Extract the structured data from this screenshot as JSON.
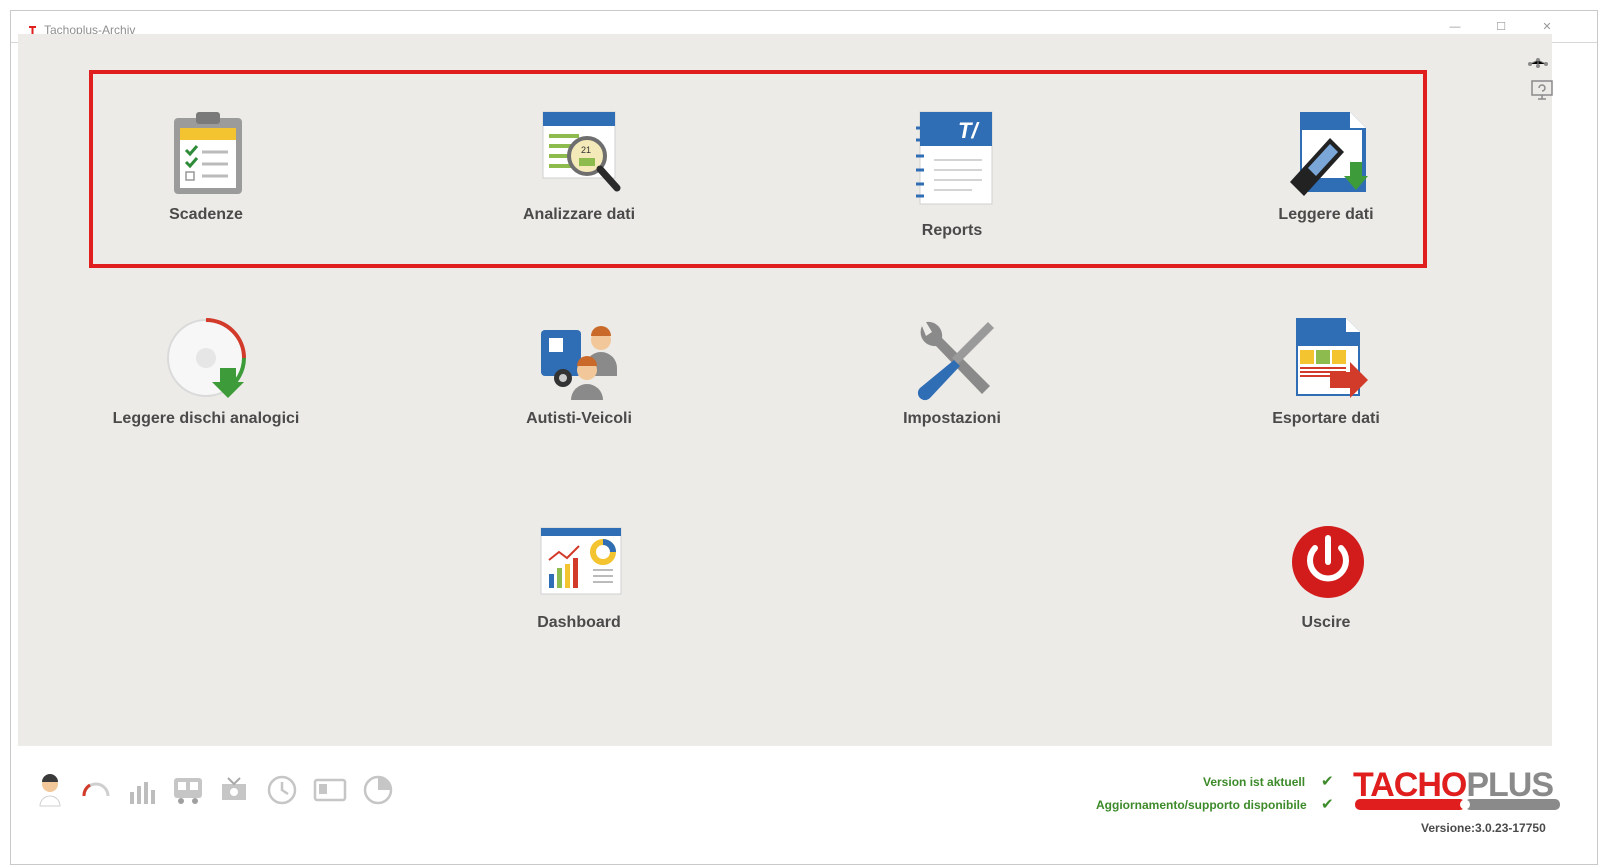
{
  "window": {
    "title": "Tachoplus-Archiv",
    "controls": [
      "minimize",
      "maximize",
      "close"
    ]
  },
  "tiles": [
    {
      "label": "Scadenze",
      "icon": "clipboard-checklist-icon"
    },
    {
      "label": "Analizzare dati",
      "icon": "calendar-magnifier-icon"
    },
    {
      "label": "Reports",
      "icon": "report-notebook-icon"
    },
    {
      "label": "Leggere dati",
      "icon": "card-reader-download-icon"
    },
    {
      "label": "Leggere dischi analogici",
      "icon": "analog-disc-download-icon"
    },
    {
      "label": "Autisti-Veicoli",
      "icon": "truck-drivers-icon"
    },
    {
      "label": "Impostazioni",
      "icon": "wrench-screwdriver-icon"
    },
    {
      "label": "Esportare dati",
      "icon": "export-document-icon"
    },
    {
      "label": "Dashboard",
      "icon": "dashboard-charts-icon"
    },
    {
      "label": "Uscire",
      "icon": "power-icon"
    }
  ],
  "highlight": {
    "color": "#e01e1e"
  },
  "side_tools": [
    "network-icon",
    "monitor-refresh-icon"
  ],
  "bottom_bar": {
    "quick_icons": [
      "driver-icon",
      "gauge-icon",
      "bar-chart-icon",
      "vehicle-icon",
      "transfer-icon",
      "clock-icon",
      "card-icon",
      "pie-icon"
    ],
    "status_version": "Version ist aktuell",
    "status_support": "Aggiornamento/supporto disponibile",
    "brand_tacho": "TACHO",
    "brand_plus": "PLUS",
    "version": "Versione:3.0.23-17750"
  },
  "colors": {
    "accent_red": "#e01e1e",
    "status_green": "#3c8a29",
    "icon_blue": "#2f6db5",
    "background": "#edebe8"
  }
}
